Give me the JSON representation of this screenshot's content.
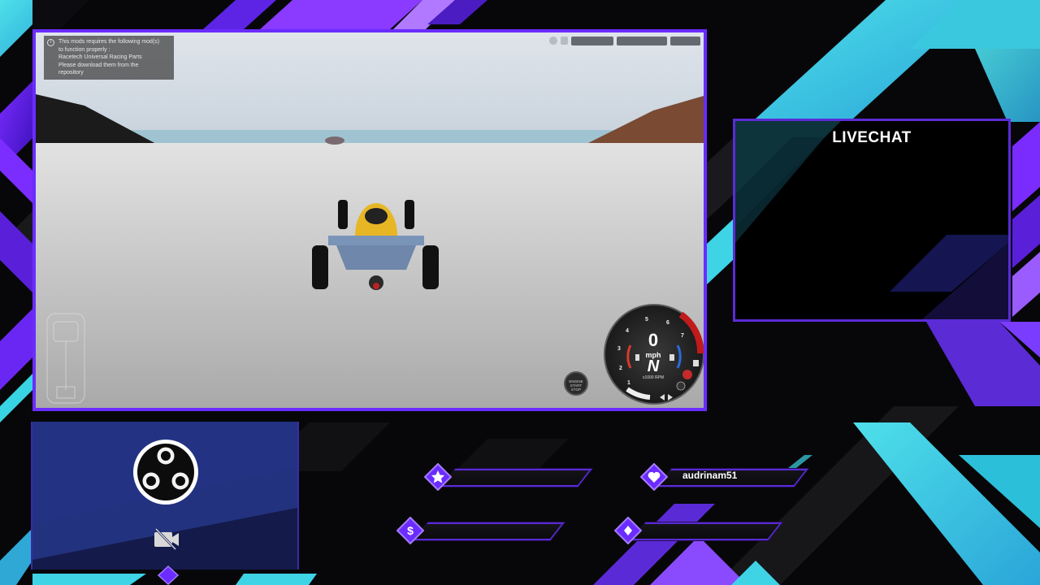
{
  "game": {
    "notice_lines": [
      "This mods requires the following mod(s)",
      "to function properly :",
      "Racetech Universal Racing Parts",
      "Please download them from the",
      "repository"
    ],
    "notice_icon": "info-icon",
    "ignition_lines": [
      "ENGINE",
      "START",
      "STOP"
    ],
    "speed_value": "0",
    "speed_unit": "mph",
    "gear": "N",
    "rpm_label": "x1000 RPM",
    "rpm_ticks": [
      "1",
      "2",
      "3",
      "4",
      "5",
      "6",
      "7"
    ],
    "gauge_icons": [
      "temperature-icon",
      "fuel-icon",
      "parking-brake-icon",
      "headlight-icon",
      "turn-signal-left-icon",
      "turn-signal-right-icon"
    ]
  },
  "livechat": {
    "title": "LIVECHAT"
  },
  "stats": {
    "star": {
      "icon": "star-icon",
      "label": ""
    },
    "follower": {
      "icon": "heart-icon",
      "label": "audrinam51"
    },
    "donation": {
      "icon": "dollar-icon",
      "label": ""
    },
    "sub": {
      "icon": "diamond-icon",
      "label": ""
    }
  },
  "camera": {
    "logo": "obs-logo",
    "status_icon": "camera-off-icon"
  },
  "colors": {
    "accent_purple": "#6a2cff",
    "accent_cyan": "#3fd3e6",
    "panel_navy": "#1f2766"
  }
}
